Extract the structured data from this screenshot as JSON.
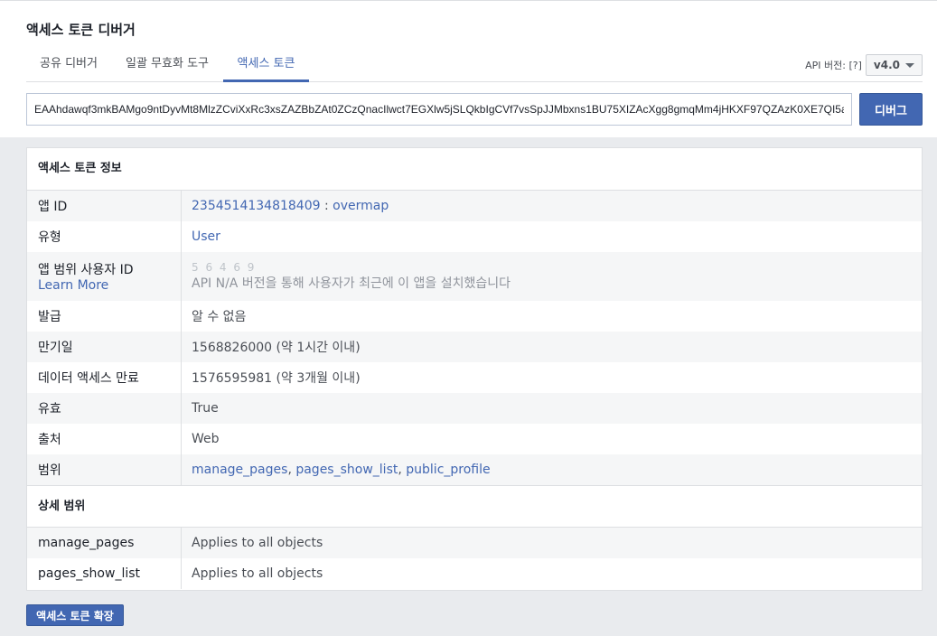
{
  "header": {
    "title": "액세스 토큰 디버거"
  },
  "tabs": [
    {
      "label": "공유 디버거"
    },
    {
      "label": "일괄 무효화 도구"
    },
    {
      "label": "액세스 토큰"
    }
  ],
  "api_version": {
    "label": "API 버전: [?]",
    "value": "v4.0"
  },
  "token_input": {
    "value": "EAAhdawqf3mkBAMgo9ntDyvMt8MlzZCviXxRc3xsZAZBbZAt0ZCzQnacIlwct7EGXlw5jSLQkbIgCVf7vsSpJJMbxns1BU75XIZAcXgg8gmqMm4jHKXF97QZAzK0XE7QI5a"
  },
  "debug_button": {
    "label": "디버그"
  },
  "token_info": {
    "title": "액세스 토큰 정보",
    "app_id": {
      "label": "앱 ID",
      "id": "2354514134818409",
      "separator": " : ",
      "app_name": "overmap"
    },
    "type": {
      "label": "유형",
      "value": "User"
    },
    "app_scoped_user": {
      "label": "앱 범위 사용자 ID",
      "learn_more": "Learn More",
      "value": "5 6 4 6 9",
      "note": "API N/A 버전을 통해 사용자가 최근에 이 앱을 설치했습니다"
    },
    "issued": {
      "label": "발급",
      "value": "알 수 없음"
    },
    "expires": {
      "label": "만기일",
      "value": "1568826000 (약 1시간 이내)"
    },
    "data_access_expires": {
      "label": "데이터 액세스 만료",
      "value": "1576595981 (약 3개월 이내)"
    },
    "valid": {
      "label": "유효",
      "value": "True"
    },
    "origin": {
      "label": "출처",
      "value": "Web"
    },
    "scopes": {
      "label": "범위",
      "items": [
        "manage_pages",
        "pages_show_list",
        "public_profile"
      ],
      "separator": ", "
    }
  },
  "granular_scopes": {
    "title": "상세 범위",
    "rows": [
      {
        "scope": "manage_pages",
        "target": "Applies to all objects"
      },
      {
        "scope": "pages_show_list",
        "target": "Applies to all objects"
      }
    ]
  },
  "extend_button": {
    "label": "액세스 토큰 확장"
  }
}
